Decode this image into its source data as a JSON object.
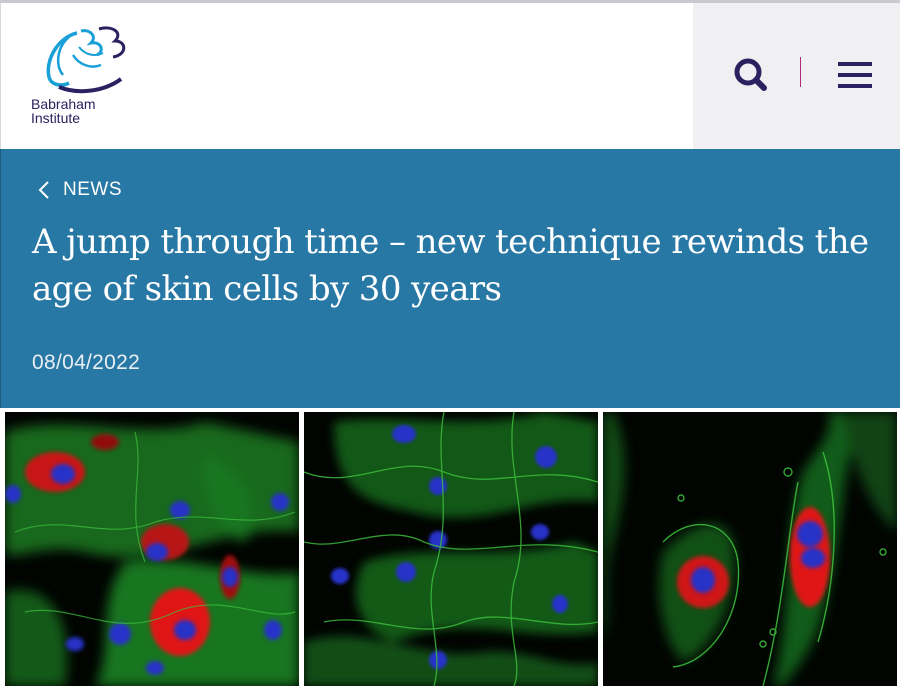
{
  "brand": {
    "name_line1": "Babraham",
    "name_line2": "Institute",
    "logo_icon": "babraham-logo-icon",
    "logo_color": "#2b2160",
    "accent_color": "#1aa0d8"
  },
  "header": {
    "search_icon": "search-icon",
    "menu_icon": "hamburger-menu-icon",
    "icon_color": "#2b2160",
    "separator_color": "#b0297a"
  },
  "hero": {
    "back_label": "NEWS",
    "title": "A jump through time – new technique rewinds the age of skin cells by 30 years",
    "date": "08/04/2022",
    "background": "#2878a5"
  },
  "images": {
    "panels": 3,
    "colors": [
      "#1fa82a",
      "#e01818",
      "#2630c8"
    ]
  }
}
